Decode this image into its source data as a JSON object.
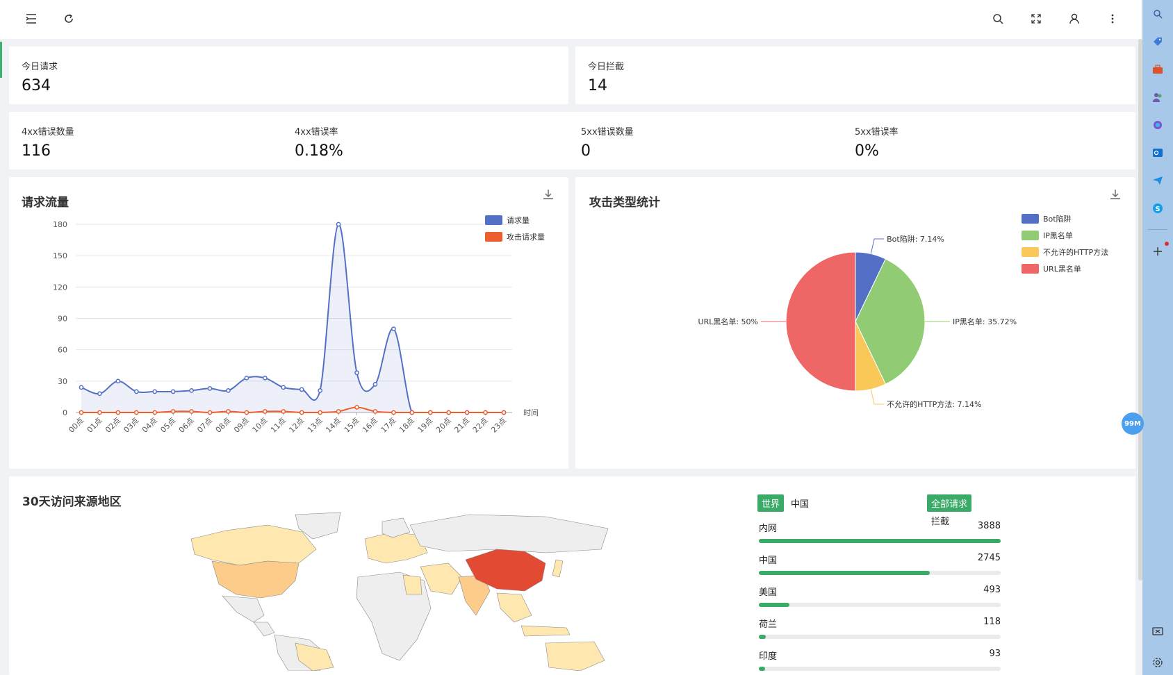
{
  "toolbar": {
    "left_icons": [
      "menu-fold-icon",
      "refresh-icon"
    ],
    "right_icons": [
      "search-icon",
      "fullscreen-icon",
      "user-icon",
      "more-icon"
    ]
  },
  "stats_top": [
    {
      "label": "今日请求",
      "value": "634"
    },
    {
      "label": "今日拦截",
      "value": "14"
    }
  ],
  "stats_errors": [
    {
      "label": "4xx错误数量",
      "value": "116"
    },
    {
      "label": "4xx错误率",
      "value": "0.18%"
    },
    {
      "label": "5xx错误数量",
      "value": "0"
    },
    {
      "label": "5xx错误率",
      "value": "0%"
    }
  ],
  "traffic_card": {
    "title": "请求流量"
  },
  "attack_card": {
    "title": "攻击类型统计"
  },
  "region_card": {
    "title": "30天访问来源地区"
  },
  "colors": {
    "accent": "#3aaa68",
    "request": "#5470c6",
    "attack": "#ee5d2e"
  },
  "chart_data": [
    {
      "type": "line",
      "title": "请求流量",
      "xlabel": "时间",
      "ylabel": "",
      "ylim": [
        0,
        180
      ],
      "yticks": [
        0,
        30,
        60,
        90,
        120,
        150,
        180
      ],
      "categories": [
        "00点",
        "01点",
        "02点",
        "03点",
        "04点",
        "05点",
        "06点",
        "07点",
        "08点",
        "09点",
        "10点",
        "11点",
        "12点",
        "13点",
        "14点",
        "15点",
        "16点",
        "17点",
        "18点",
        "19点",
        "20点",
        "21点",
        "22点",
        "23点"
      ],
      "series": [
        {
          "name": "请求量",
          "color": "#5470c6",
          "area": true,
          "values": [
            24,
            18,
            30,
            20,
            20,
            20,
            21,
            23,
            21,
            33,
            33,
            24,
            22,
            21,
            180,
            38,
            27,
            80,
            0,
            0,
            0,
            0,
            0,
            0
          ]
        },
        {
          "name": "攻击请求量",
          "color": "#ee5d2e",
          "area": false,
          "values": [
            0,
            0,
            0,
            0,
            0,
            1,
            1,
            0,
            1,
            0,
            1,
            1,
            0,
            0,
            1,
            5,
            1,
            0,
            0,
            0,
            0,
            0,
            0,
            0
          ]
        }
      ],
      "legend": "top-right",
      "grid": true
    },
    {
      "type": "pie",
      "title": "攻击类型统计",
      "slices": [
        {
          "name": "Bot陷阱",
          "value": 7.14,
          "label": "Bot陷阱: 7.14%",
          "color": "#5470c6"
        },
        {
          "name": "IP黑名单",
          "value": 35.72,
          "label": "IP黑名单: 35.72%",
          "color": "#91cc75"
        },
        {
          "name": "不允许的HTTP方法",
          "value": 7.14,
          "label": "不允许的HTTP方法: 7.14%",
          "color": "#fac858"
        },
        {
          "name": "URL黑名单",
          "value": 50,
          "label": "URL黑名单: 50%",
          "color": "#ee6666"
        }
      ],
      "legend": "top-right"
    }
  ],
  "region_tabs": {
    "scope": [
      {
        "label": "世界",
        "active": true
      },
      {
        "label": "中国",
        "active": false
      }
    ],
    "kind": [
      {
        "label": "全部请求",
        "active": true
      },
      {
        "label": "拦截",
        "active": false
      }
    ]
  },
  "regions": [
    {
      "name": "内网",
      "count": "3888",
      "ratio": 1.0
    },
    {
      "name": "中国",
      "count": "2745",
      "ratio": 0.706
    },
    {
      "name": "美国",
      "count": "493",
      "ratio": 0.127
    },
    {
      "name": "荷兰",
      "count": "118",
      "ratio": 0.03
    },
    {
      "name": "印度",
      "count": "93",
      "ratio": 0.024
    }
  ],
  "map": {
    "highlight_color": "#e34a33",
    "mid_color": "#fdcc8a",
    "light_color": "#fee8b0",
    "base_color": "#eeeeee"
  },
  "sidebar_icons": [
    "search-icon",
    "tag-icon",
    "toolbox-icon",
    "people-icon",
    "copilot-icon",
    "outlook-icon",
    "send-icon",
    "skype-icon",
    "add-icon",
    "screenshot-icon",
    "settings-icon"
  ],
  "memory_badge": "99M"
}
